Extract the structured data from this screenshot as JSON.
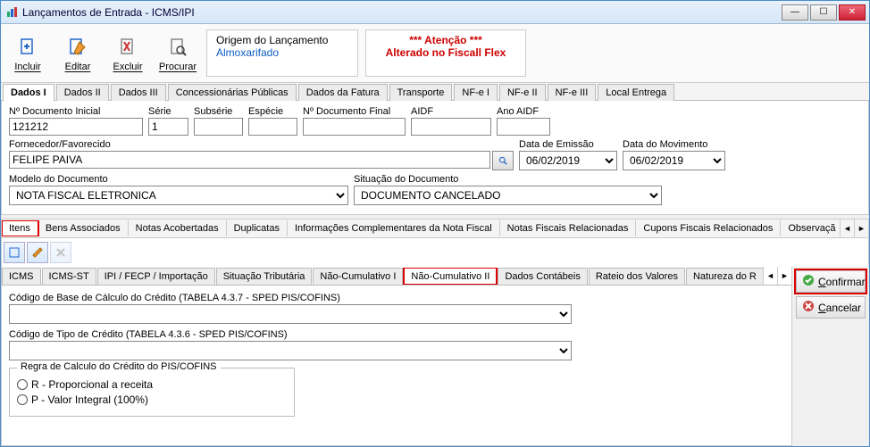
{
  "window": {
    "title": "Lançamentos de Entrada - ICMS/IPI"
  },
  "toolbar": {
    "include": "Incluir",
    "edit": "Editar",
    "delete": "Excluir",
    "search": "Procurar"
  },
  "origin": {
    "label": "Origem do Lançamento",
    "value": "Almoxarifado"
  },
  "warning": {
    "line1": "*** Atenção ***",
    "line2": "Alterado no Fiscall Flex"
  },
  "mainTabs": [
    "Dados I",
    "Dados II",
    "Dados III",
    "Concessionárias Públicas",
    "Dados da Fatura",
    "Transporte",
    "NF-e I",
    "NF-e II",
    "NF-e III",
    "Local Entrega"
  ],
  "fields": {
    "docIni": {
      "label": "Nº Documento Inicial",
      "value": "121212"
    },
    "serie": {
      "label": "Série",
      "value": "1"
    },
    "subserie": {
      "label": "Subsérie",
      "value": ""
    },
    "especie": {
      "label": "Espécie",
      "value": ""
    },
    "docFin": {
      "label": "Nº Documento Final",
      "value": ""
    },
    "aidf": {
      "label": "AIDF",
      "value": ""
    },
    "anoAidf": {
      "label": "Ano AIDF",
      "value": ""
    },
    "fornecedor": {
      "label": "Fornecedor/Favorecido",
      "value": "FELIPE PAIVA"
    },
    "dataEmissao": {
      "label": "Data de Emissão",
      "value": "06/02/2019"
    },
    "dataMov": {
      "label": "Data do Movimento",
      "value": "06/02/2019"
    },
    "modelo": {
      "label": "Modelo do Documento",
      "value": "NOTA FISCAL ELETRONICA"
    },
    "situacao": {
      "label": "Situação do Documento",
      "value": "DOCUMENTO CANCELADO"
    }
  },
  "subTabs": [
    "Itens",
    "Bens Associados",
    "Notas Acobertadas",
    "Duplicatas",
    "Informações Complementares da Nota Fiscal",
    "Notas Fiscais Relacionadas",
    "Cupons Fiscais Relacionados",
    "Observaçã"
  ],
  "innerTabs": [
    "ICMS",
    "ICMS-ST",
    "IPI / FECP / Importação",
    "Situação Tributária",
    "Não-Cumulativo I",
    "Não-Cumulativo II",
    "Dados Contábeis",
    "Rateio dos Valores",
    "Natureza do R"
  ],
  "sideButtons": {
    "confirm": "Confirmar",
    "cancel": "Cancelar"
  },
  "inner": {
    "codBase": {
      "label": "Código de Base de Cálculo do Crédito (TABELA 4.3.7 - SPED PIS/COFINS)"
    },
    "codTipo": {
      "label": "Código de Tipo de Crédito (TABELA 4.3.6 - SPED PIS/COFINS)"
    },
    "groupTitle": "Regra de Calculo do Crédito do PIS/COFINS",
    "optR": "R - Proporcional a receita",
    "optP": "P - Valor Integral (100%)"
  }
}
